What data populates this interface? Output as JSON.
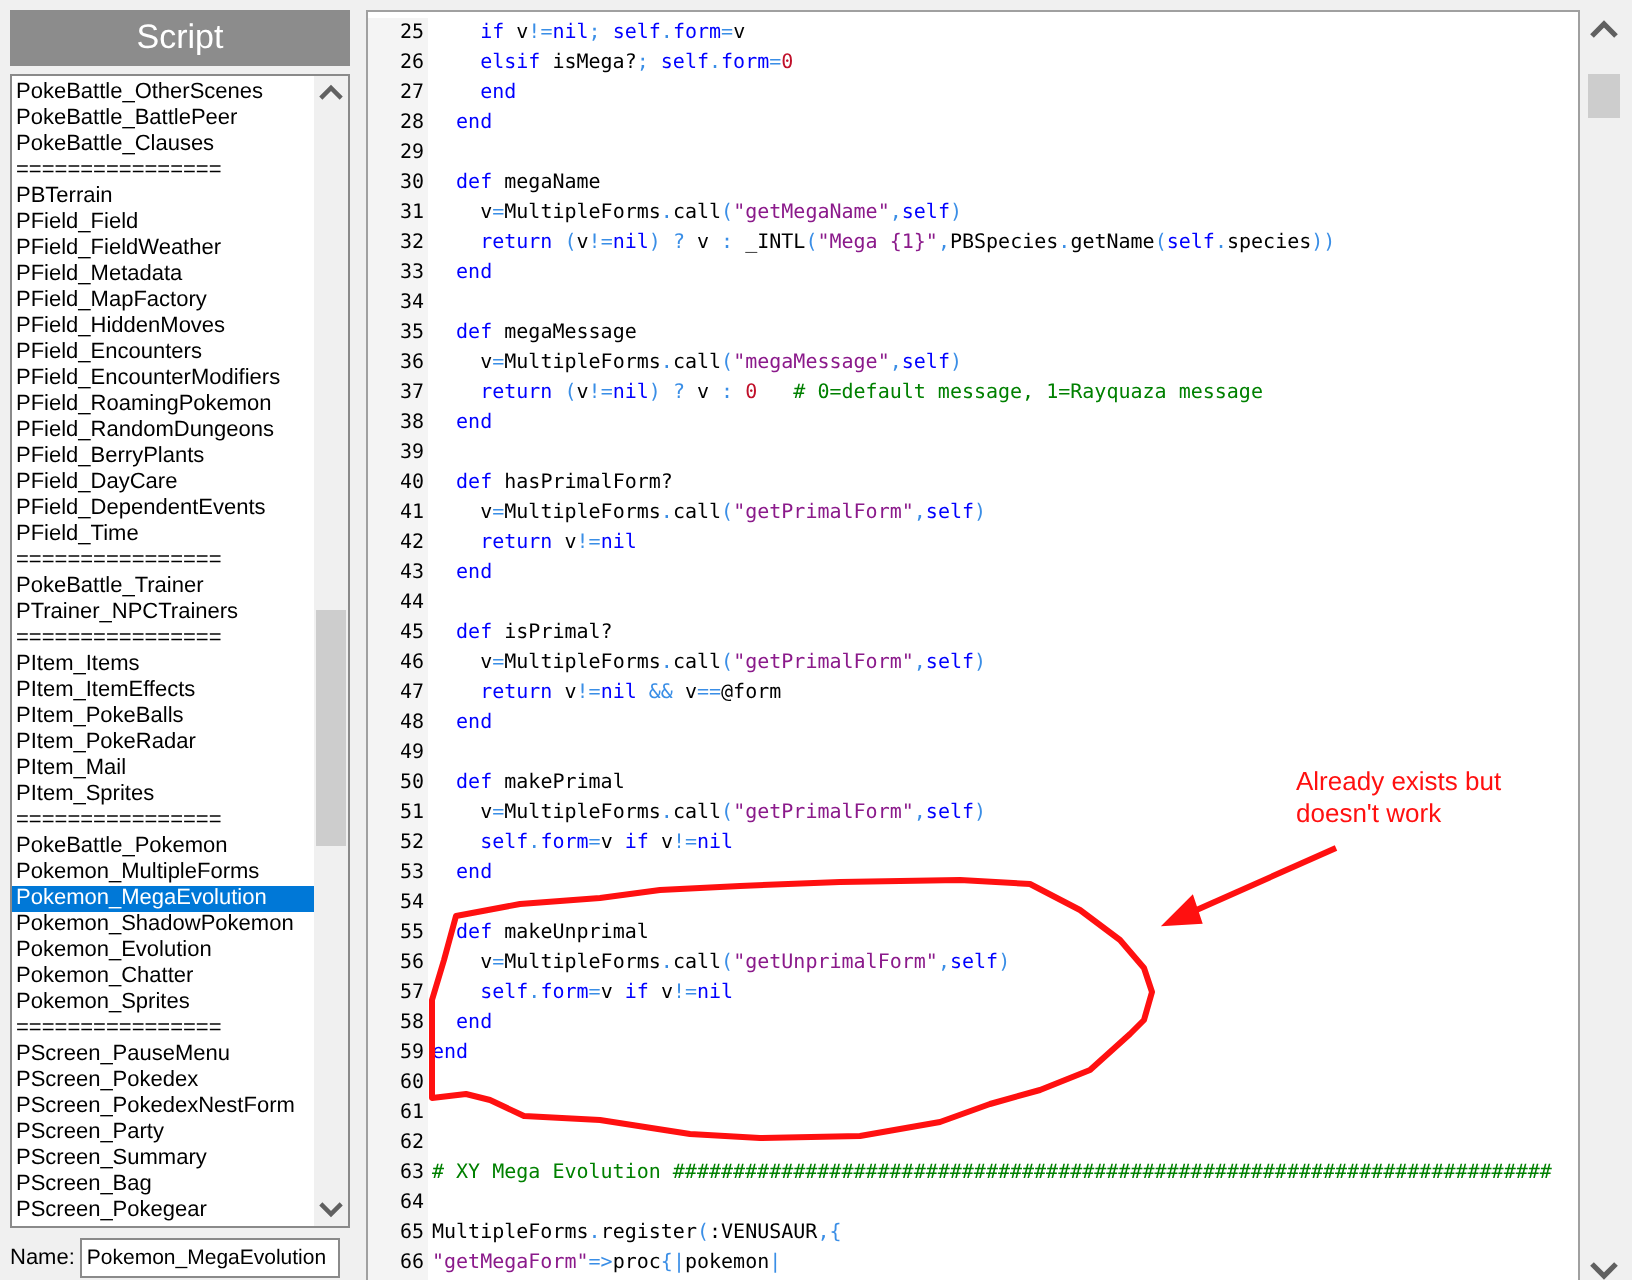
{
  "script_panel": {
    "title": "Script",
    "items": [
      {
        "label": "PokeBattle_OtherScenes",
        "selected": false
      },
      {
        "label": "PokeBattle_BattlePeer",
        "selected": false
      },
      {
        "label": "PokeBattle_Clauses",
        "selected": false
      },
      {
        "label": "================",
        "selected": false
      },
      {
        "label": "PBTerrain",
        "selected": false
      },
      {
        "label": "PField_Field",
        "selected": false
      },
      {
        "label": "PField_FieldWeather",
        "selected": false
      },
      {
        "label": "PField_Metadata",
        "selected": false
      },
      {
        "label": "PField_MapFactory",
        "selected": false
      },
      {
        "label": "PField_HiddenMoves",
        "selected": false
      },
      {
        "label": "PField_Encounters",
        "selected": false
      },
      {
        "label": "PField_EncounterModifiers",
        "selected": false
      },
      {
        "label": "PField_RoamingPokemon",
        "selected": false
      },
      {
        "label": "PField_RandomDungeons",
        "selected": false
      },
      {
        "label": "PField_BerryPlants",
        "selected": false
      },
      {
        "label": "PField_DayCare",
        "selected": false
      },
      {
        "label": "PField_DependentEvents",
        "selected": false
      },
      {
        "label": "PField_Time",
        "selected": false
      },
      {
        "label": "================",
        "selected": false
      },
      {
        "label": "PokeBattle_Trainer",
        "selected": false
      },
      {
        "label": "PTrainer_NPCTrainers",
        "selected": false
      },
      {
        "label": "================",
        "selected": false
      },
      {
        "label": "PItem_Items",
        "selected": false
      },
      {
        "label": "PItem_ItemEffects",
        "selected": false
      },
      {
        "label": "PItem_PokeBalls",
        "selected": false
      },
      {
        "label": "PItem_PokeRadar",
        "selected": false
      },
      {
        "label": "PItem_Mail",
        "selected": false
      },
      {
        "label": "PItem_Sprites",
        "selected": false
      },
      {
        "label": "================",
        "selected": false
      },
      {
        "label": "PokeBattle_Pokemon",
        "selected": false
      },
      {
        "label": "Pokemon_MultipleForms",
        "selected": false
      },
      {
        "label": "Pokemon_MegaEvolution",
        "selected": true
      },
      {
        "label": "Pokemon_ShadowPokemon",
        "selected": false
      },
      {
        "label": "Pokemon_Evolution",
        "selected": false
      },
      {
        "label": "Pokemon_Chatter",
        "selected": false
      },
      {
        "label": "Pokemon_Sprites",
        "selected": false
      },
      {
        "label": "================",
        "selected": false
      },
      {
        "label": "PScreen_PauseMenu",
        "selected": false
      },
      {
        "label": "PScreen_Pokedex",
        "selected": false
      },
      {
        "label": "PScreen_PokedexNestForm",
        "selected": false
      },
      {
        "label": "PScreen_Party",
        "selected": false
      },
      {
        "label": "PScreen_Summary",
        "selected": false
      },
      {
        "label": "PScreen_Bag",
        "selected": false
      },
      {
        "label": "PScreen_Pokegear",
        "selected": false
      }
    ],
    "name_label": "Name:",
    "name_value": "Pokemon_MegaEvolution"
  },
  "editor": {
    "lines": [
      {
        "number": "25",
        "tokens": [
          {
            "kind": "kw",
            "text": "    if"
          },
          {
            "kind": "id",
            "text": " v"
          },
          {
            "kind": "op",
            "text": "!="
          },
          {
            "kind": "kw",
            "text": "nil"
          },
          {
            "kind": "op",
            "text": ";"
          },
          {
            "kind": "kw",
            "text": " self"
          },
          {
            "kind": "op",
            "text": "."
          },
          {
            "kind": "kw",
            "text": "form"
          },
          {
            "kind": "op",
            "text": "="
          },
          {
            "kind": "id",
            "text": "v"
          }
        ]
      },
      {
        "number": "26",
        "tokens": [
          {
            "kind": "kw",
            "text": "    elsif"
          },
          {
            "kind": "id",
            "text": " isMega?"
          },
          {
            "kind": "op",
            "text": ";"
          },
          {
            "kind": "kw",
            "text": " self"
          },
          {
            "kind": "op",
            "text": "."
          },
          {
            "kind": "kw",
            "text": "form"
          },
          {
            "kind": "op",
            "text": "="
          },
          {
            "kind": "num",
            "text": "0"
          }
        ]
      },
      {
        "number": "27",
        "tokens": [
          {
            "kind": "kw",
            "text": "    end"
          }
        ]
      },
      {
        "number": "28",
        "tokens": [
          {
            "kind": "kw",
            "text": "  end"
          }
        ]
      },
      {
        "number": "29"
      },
      {
        "number": "30",
        "tokens": [
          {
            "kind": "kw",
            "text": "  def"
          },
          {
            "kind": "id",
            "text": " megaName"
          }
        ]
      },
      {
        "number": "31",
        "tokens": [
          {
            "kind": "id",
            "text": "    v"
          },
          {
            "kind": "op",
            "text": "="
          },
          {
            "kind": "id",
            "text": "MultipleForms"
          },
          {
            "kind": "op",
            "text": "."
          },
          {
            "kind": "id",
            "text": "call"
          },
          {
            "kind": "op",
            "text": "("
          },
          {
            "kind": "str",
            "text": "\"getMegaName\""
          },
          {
            "kind": "op",
            "text": ","
          },
          {
            "kind": "kw",
            "text": "self"
          },
          {
            "kind": "op",
            "text": ")"
          }
        ]
      },
      {
        "number": "32",
        "tokens": [
          {
            "kind": "kw",
            "text": "    return"
          },
          {
            "kind": "op",
            "text": " ("
          },
          {
            "kind": "id",
            "text": "v"
          },
          {
            "kind": "op",
            "text": "!="
          },
          {
            "kind": "kw",
            "text": "nil"
          },
          {
            "kind": "op",
            "text": ") ?"
          },
          {
            "kind": "id",
            "text": " v "
          },
          {
            "kind": "op",
            "text": ":"
          },
          {
            "kind": "id",
            "text": " _INTL"
          },
          {
            "kind": "op",
            "text": "("
          },
          {
            "kind": "str",
            "text": "\"Mega {1}\""
          },
          {
            "kind": "op",
            "text": ","
          },
          {
            "kind": "id",
            "text": "PBSpecies"
          },
          {
            "kind": "op",
            "text": "."
          },
          {
            "kind": "id",
            "text": "getName"
          },
          {
            "kind": "op",
            "text": "("
          },
          {
            "kind": "kw",
            "text": "self"
          },
          {
            "kind": "op",
            "text": "."
          },
          {
            "kind": "id",
            "text": "species"
          },
          {
            "kind": "op",
            "text": "))"
          }
        ]
      },
      {
        "number": "33",
        "tokens": [
          {
            "kind": "kw",
            "text": "  end"
          }
        ]
      },
      {
        "number": "34"
      },
      {
        "number": "35",
        "tokens": [
          {
            "kind": "kw",
            "text": "  def"
          },
          {
            "kind": "id",
            "text": " megaMessage"
          }
        ]
      },
      {
        "number": "36",
        "tokens": [
          {
            "kind": "id",
            "text": "    v"
          },
          {
            "kind": "op",
            "text": "="
          },
          {
            "kind": "id",
            "text": "MultipleForms"
          },
          {
            "kind": "op",
            "text": "."
          },
          {
            "kind": "id",
            "text": "call"
          },
          {
            "kind": "op",
            "text": "("
          },
          {
            "kind": "str",
            "text": "\"megaMessage\""
          },
          {
            "kind": "op",
            "text": ","
          },
          {
            "kind": "kw",
            "text": "self"
          },
          {
            "kind": "op",
            "text": ")"
          }
        ]
      },
      {
        "number": "37",
        "tokens": [
          {
            "kind": "kw",
            "text": "    return"
          },
          {
            "kind": "op",
            "text": " ("
          },
          {
            "kind": "id",
            "text": "v"
          },
          {
            "kind": "op",
            "text": "!="
          },
          {
            "kind": "kw",
            "text": "nil"
          },
          {
            "kind": "op",
            "text": ") ?"
          },
          {
            "kind": "id",
            "text": " v "
          },
          {
            "kind": "op",
            "text": ":"
          },
          {
            "kind": "num",
            "text": " 0"
          },
          {
            "kind": "comment",
            "text": "   # 0=default message, 1=Rayquaza message"
          }
        ]
      },
      {
        "number": "38",
        "tokens": [
          {
            "kind": "kw",
            "text": "  end"
          }
        ]
      },
      {
        "number": "39"
      },
      {
        "number": "40",
        "tokens": [
          {
            "kind": "kw",
            "text": "  def"
          },
          {
            "kind": "id",
            "text": " hasPrimalForm?"
          }
        ]
      },
      {
        "number": "41",
        "tokens": [
          {
            "kind": "id",
            "text": "    v"
          },
          {
            "kind": "op",
            "text": "="
          },
          {
            "kind": "id",
            "text": "MultipleForms"
          },
          {
            "kind": "op",
            "text": "."
          },
          {
            "kind": "id",
            "text": "call"
          },
          {
            "kind": "op",
            "text": "("
          },
          {
            "kind": "str",
            "text": "\"getPrimalForm\""
          },
          {
            "kind": "op",
            "text": ","
          },
          {
            "kind": "kw",
            "text": "self"
          },
          {
            "kind": "op",
            "text": ")"
          }
        ]
      },
      {
        "number": "42",
        "tokens": [
          {
            "kind": "kw",
            "text": "    return"
          },
          {
            "kind": "id",
            "text": " v"
          },
          {
            "kind": "op",
            "text": "!="
          },
          {
            "kind": "kw",
            "text": "nil"
          }
        ]
      },
      {
        "number": "43",
        "tokens": [
          {
            "kind": "kw",
            "text": "  end"
          }
        ]
      },
      {
        "number": "44"
      },
      {
        "number": "45",
        "tokens": [
          {
            "kind": "kw",
            "text": "  def"
          },
          {
            "kind": "id",
            "text": " isPrimal?"
          }
        ]
      },
      {
        "number": "46",
        "tokens": [
          {
            "kind": "id",
            "text": "    v"
          },
          {
            "kind": "op",
            "text": "="
          },
          {
            "kind": "id",
            "text": "MultipleForms"
          },
          {
            "kind": "op",
            "text": "."
          },
          {
            "kind": "id",
            "text": "call"
          },
          {
            "kind": "op",
            "text": "("
          },
          {
            "kind": "str",
            "text": "\"getPrimalForm\""
          },
          {
            "kind": "op",
            "text": ","
          },
          {
            "kind": "kw",
            "text": "self"
          },
          {
            "kind": "op",
            "text": ")"
          }
        ]
      },
      {
        "number": "47",
        "tokens": [
          {
            "kind": "kw",
            "text": "    return"
          },
          {
            "kind": "id",
            "text": " v"
          },
          {
            "kind": "op",
            "text": "!="
          },
          {
            "kind": "kw",
            "text": "nil"
          },
          {
            "kind": "op",
            "text": " &&"
          },
          {
            "kind": "id",
            "text": " v"
          },
          {
            "kind": "op",
            "text": "=="
          },
          {
            "kind": "id",
            "text": "@form"
          }
        ]
      },
      {
        "number": "48",
        "tokens": [
          {
            "kind": "kw",
            "text": "  end"
          }
        ]
      },
      {
        "number": "49"
      },
      {
        "number": "50",
        "tokens": [
          {
            "kind": "kw",
            "text": "  def"
          },
          {
            "kind": "id",
            "text": " makePrimal"
          }
        ]
      },
      {
        "number": "51",
        "tokens": [
          {
            "kind": "id",
            "text": "    v"
          },
          {
            "kind": "op",
            "text": "="
          },
          {
            "kind": "id",
            "text": "MultipleForms"
          },
          {
            "kind": "op",
            "text": "."
          },
          {
            "kind": "id",
            "text": "call"
          },
          {
            "kind": "op",
            "text": "("
          },
          {
            "kind": "str",
            "text": "\"getPrimalForm\""
          },
          {
            "kind": "op",
            "text": ","
          },
          {
            "kind": "kw",
            "text": "self"
          },
          {
            "kind": "op",
            "text": ")"
          }
        ]
      },
      {
        "number": "52",
        "tokens": [
          {
            "kind": "kw",
            "text": "    self"
          },
          {
            "kind": "op",
            "text": "."
          },
          {
            "kind": "kw",
            "text": "form"
          },
          {
            "kind": "op",
            "text": "="
          },
          {
            "kind": "id",
            "text": "v "
          },
          {
            "kind": "kw",
            "text": "if"
          },
          {
            "kind": "id",
            "text": " v"
          },
          {
            "kind": "op",
            "text": "!="
          },
          {
            "kind": "kw",
            "text": "nil"
          }
        ]
      },
      {
        "number": "53",
        "tokens": [
          {
            "kind": "kw",
            "text": "  end"
          }
        ]
      },
      {
        "number": "54"
      },
      {
        "number": "55",
        "tokens": [
          {
            "kind": "kw",
            "text": "  def"
          },
          {
            "kind": "id",
            "text": " makeUnprimal"
          }
        ]
      },
      {
        "number": "56",
        "tokens": [
          {
            "kind": "id",
            "text": "    v"
          },
          {
            "kind": "op",
            "text": "="
          },
          {
            "kind": "id",
            "text": "MultipleForms"
          },
          {
            "kind": "op",
            "text": "."
          },
          {
            "kind": "id",
            "text": "call"
          },
          {
            "kind": "op",
            "text": "("
          },
          {
            "kind": "str",
            "text": "\"getUnprimalForm\""
          },
          {
            "kind": "op",
            "text": ","
          },
          {
            "kind": "kw",
            "text": "self"
          },
          {
            "kind": "op",
            "text": ")"
          }
        ]
      },
      {
        "number": "57",
        "tokens": [
          {
            "kind": "kw",
            "text": "    self"
          },
          {
            "kind": "op",
            "text": "."
          },
          {
            "kind": "kw",
            "text": "form"
          },
          {
            "kind": "op",
            "text": "="
          },
          {
            "kind": "id",
            "text": "v "
          },
          {
            "kind": "kw",
            "text": "if"
          },
          {
            "kind": "id",
            "text": " v"
          },
          {
            "kind": "op",
            "text": "!="
          },
          {
            "kind": "kw",
            "text": "nil"
          }
        ]
      },
      {
        "number": "58",
        "tokens": [
          {
            "kind": "kw",
            "text": "  end"
          }
        ]
      },
      {
        "number": "59",
        "tokens": [
          {
            "kind": "kw",
            "text": "end"
          }
        ]
      },
      {
        "number": "60"
      },
      {
        "number": "61"
      },
      {
        "number": "62"
      },
      {
        "number": "63",
        "tokens": [
          {
            "kind": "comment",
            "text": "# XY Mega Evolution #########################################################################"
          }
        ]
      },
      {
        "number": "64"
      },
      {
        "number": "65",
        "tokens": [
          {
            "kind": "id",
            "text": "MultipleForms"
          },
          {
            "kind": "op",
            "text": "."
          },
          {
            "kind": "id",
            "text": "register"
          },
          {
            "kind": "op",
            "text": "("
          },
          {
            "kind": "id",
            "text": ":VENUSAUR"
          },
          {
            "kind": "op",
            "text": ",{"
          }
        ]
      },
      {
        "number": "66",
        "tokens": [
          {
            "kind": "str",
            "text": "\"getMegaForm\""
          },
          {
            "kind": "op",
            "text": "=>"
          },
          {
            "kind": "id",
            "text": "proc"
          },
          {
            "kind": "op",
            "text": "{|"
          },
          {
            "kind": "id",
            "text": "pokemon"
          },
          {
            "kind": "op",
            "text": "|"
          }
        ]
      }
    ]
  },
  "annotation": {
    "note": "Already exists but doesn't work"
  }
}
